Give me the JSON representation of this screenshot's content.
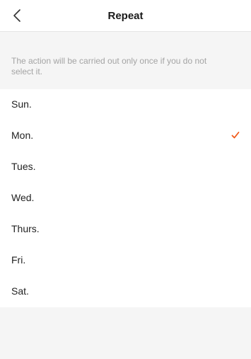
{
  "header": {
    "title": "Repeat",
    "back_icon": "chevron-left-icon"
  },
  "hint": "The action will be carried out only once if you do not select it.",
  "days": [
    {
      "label": "Sun.",
      "selected": false
    },
    {
      "label": "Mon.",
      "selected": true
    },
    {
      "label": "Tues.",
      "selected": false
    },
    {
      "label": "Wed.",
      "selected": false
    },
    {
      "label": "Thurs.",
      "selected": false
    },
    {
      "label": "Fri.",
      "selected": false
    },
    {
      "label": "Sat.",
      "selected": false
    }
  ],
  "colors": {
    "accent": "#f05a1a",
    "background": "#f5f5f5"
  }
}
